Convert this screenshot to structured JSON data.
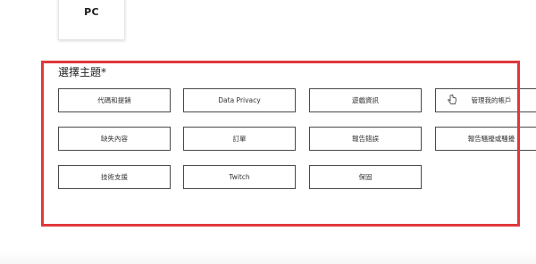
{
  "platform_card": {
    "label": "PC",
    "icon": "xbox-logo-icon"
  },
  "topic_section": {
    "title": "選擇主題*",
    "highlight_color": "#e0383d",
    "buttons": [
      {
        "label": "代碼和提銷"
      },
      {
        "label": "Data Privacy"
      },
      {
        "label": "遊戲資訊"
      },
      {
        "label": "管理我的帳戶",
        "icon": "hand-cursor-icon"
      },
      {
        "label": "缺失內容"
      },
      {
        "label": "訂單"
      },
      {
        "label": "報告錯誤"
      },
      {
        "label": "報告騷擾或騷擾"
      },
      {
        "label": "技術支援"
      },
      {
        "label": "Twitch"
      },
      {
        "label": "保固"
      }
    ]
  }
}
